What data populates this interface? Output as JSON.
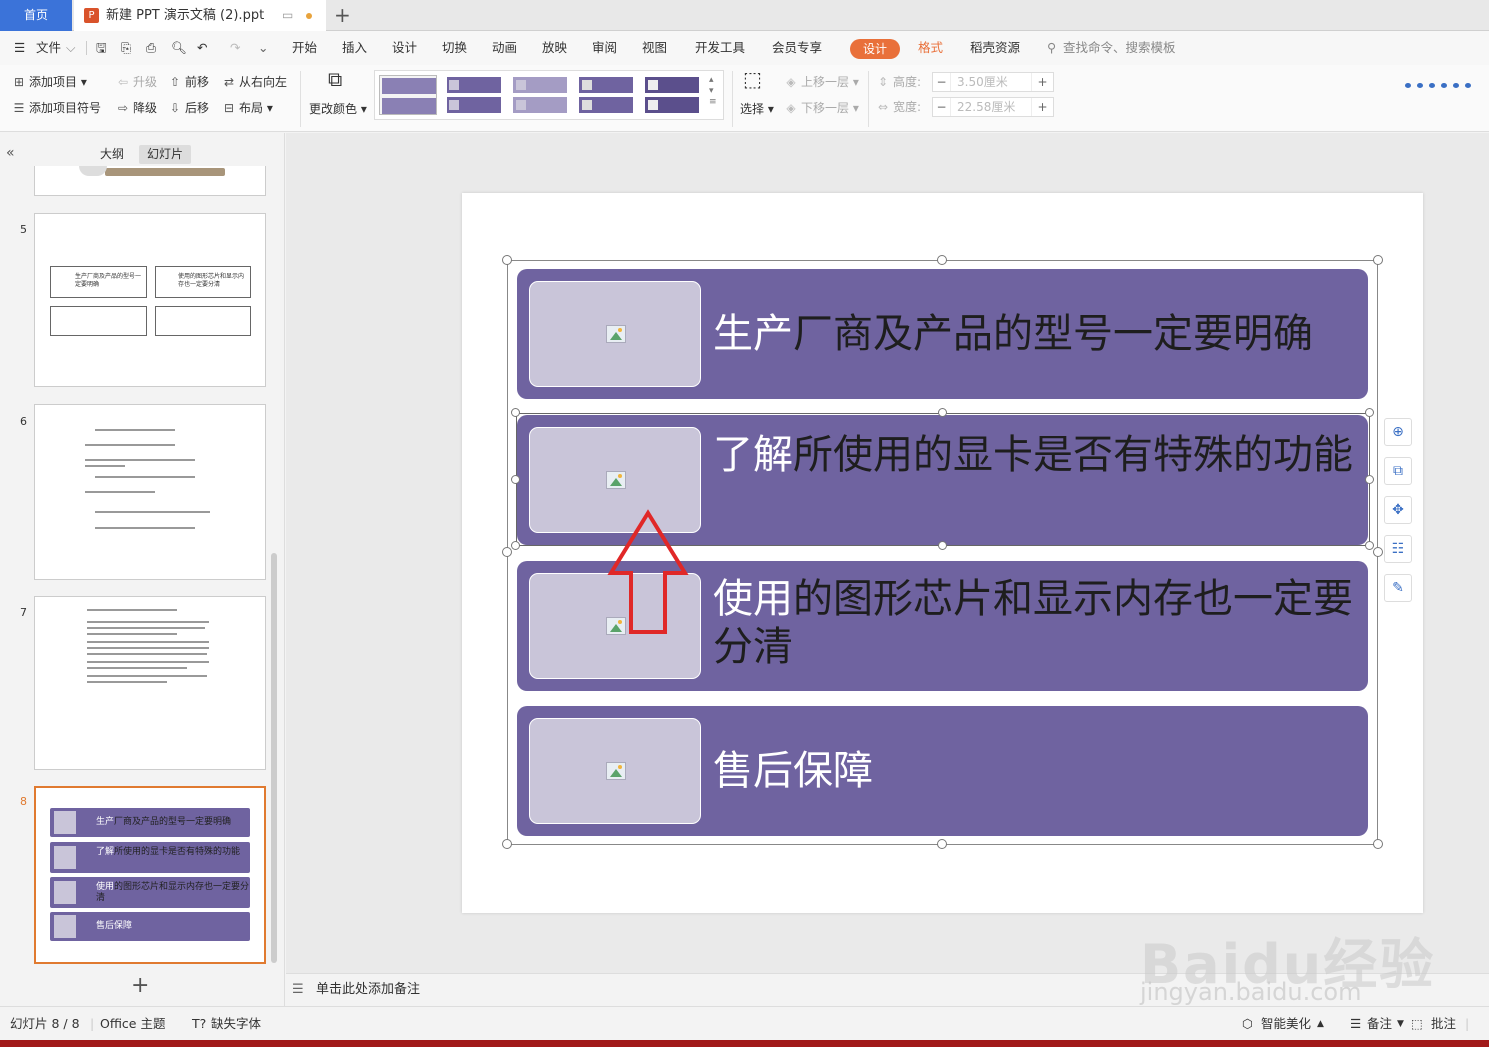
{
  "tabs": {
    "home": "首页",
    "doc_title": "新建 PPT 演示文稿 (2).ppt",
    "add": "+"
  },
  "menu": {
    "file": "文件",
    "items": [
      "开始",
      "插入",
      "设计",
      "切换",
      "动画",
      "放映",
      "审阅",
      "视图",
      "开发工具",
      "会员专享"
    ],
    "design_tab": "设计",
    "format_tab": "格式",
    "resources": "稻壳资源",
    "search": "查找命令、搜索模板"
  },
  "ribbon": {
    "add_item": "添加项目",
    "add_bullet": "添加项目符号",
    "promote": "升级",
    "demote": "降级",
    "move_up": "前移",
    "move_down": "后移",
    "rtl": "从右向左",
    "layout": "布局",
    "change_color": "更改颜色",
    "select": "选择",
    "bring_forward": "上移一层",
    "send_backward": "下移一层",
    "height_label": "高度:",
    "height_value": "3.50厘米",
    "width_label": "宽度:",
    "width_value": "22.58厘米"
  },
  "panel": {
    "outline_tab": "大纲",
    "slides_tab": "幻灯片",
    "collapse": "«"
  },
  "thumbs": [
    {
      "num": "5"
    },
    {
      "num": "6"
    },
    {
      "num": "7"
    },
    {
      "num": "8"
    }
  ],
  "slide": {
    "rows": [
      {
        "white": "生产",
        "dark": "厂商及产品的型号一定要明确"
      },
      {
        "white": "了解",
        "dark": "所使用的显卡是否有特殊的功能"
      },
      {
        "white": "使用",
        "dark": "的图形芯片和显示内存也一定要分清"
      },
      {
        "white": "售后保障",
        "dark": ""
      }
    ]
  },
  "notes": {
    "placeholder": "单击此处添加备注"
  },
  "status": {
    "slide_count": "幻灯片 8 / 8",
    "theme": "Office 主题",
    "missing_font": "缺失字体",
    "smart_beautify": "智能美化",
    "notes": "备注",
    "comments": "批注"
  },
  "watermark": {
    "logo": "Baidu经验",
    "url": "jingyan.baidu.com"
  },
  "colors": {
    "accent": "#6f63a0",
    "placeholder": "#c9c5d9",
    "design_pill": "#e9703a",
    "selected_thumb": "#e07a30",
    "arrow": "#e02828"
  }
}
